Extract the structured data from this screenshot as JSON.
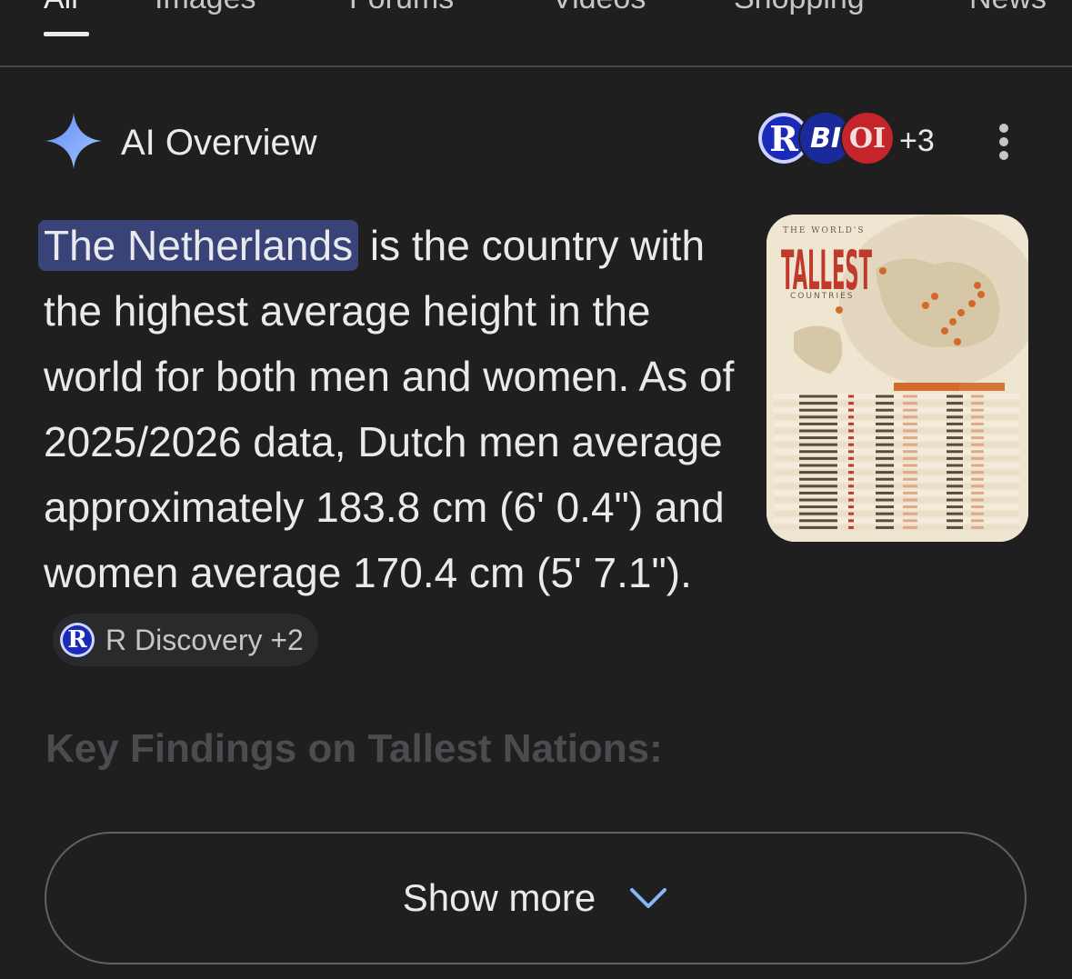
{
  "tabs": [
    {
      "label": "All",
      "active": true
    },
    {
      "label": "Images"
    },
    {
      "label": "Forums"
    },
    {
      "label": "Videos"
    },
    {
      "label": "Shopping"
    },
    {
      "label": "News"
    }
  ],
  "ai_overview": {
    "title": "AI Overview",
    "icon": "sparkle-icon",
    "sources": [
      {
        "initials": "R",
        "color": "#1a2bb8"
      },
      {
        "initials": "BI",
        "color": "#1b2a9a"
      },
      {
        "initials": "OI",
        "color": "#c3252b"
      }
    ],
    "more_sources": "+3",
    "menu_icon": "more-vert-icon"
  },
  "answer": {
    "highlight": "The Netherlands",
    "text": " is the country with the highest average height in the world for both men and women. As of 2025/2026 data, Dutch men average approximately 183.8 cm (6' 0.4\") and women average 170.4 cm (5' 7.1\").",
    "citation": {
      "icon_letter": "R",
      "label": "R Discovery +2"
    }
  },
  "thumbnail": {
    "header_small": "THE WORLD'S",
    "header_big": "TALLEST",
    "header_sub": "COUNTRIES"
  },
  "faded_heading": "Key Findings on Tallest Nations:",
  "show_more": {
    "label": "Show more",
    "icon": "chevron-down-icon"
  },
  "colors": {
    "background": "#1f1f1f",
    "highlight": "#394377",
    "accent_sparkle": "#8ab4f8",
    "chip_background": "#282a2c"
  }
}
